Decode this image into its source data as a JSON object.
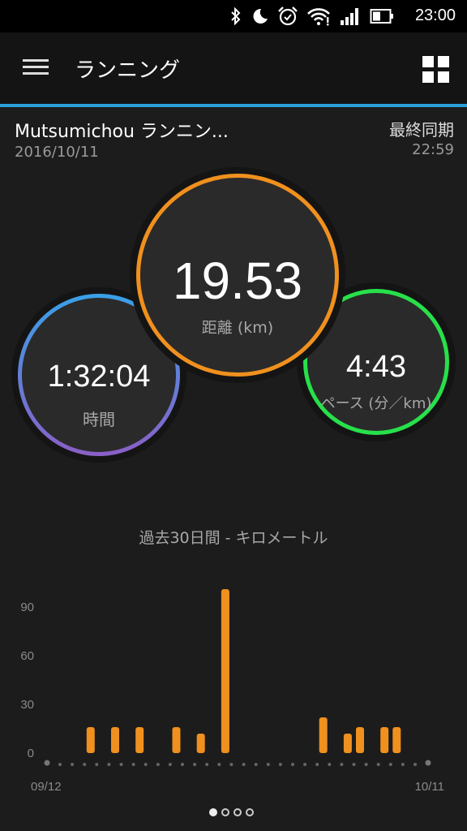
{
  "status_bar": {
    "time": "23:00",
    "icons": [
      "bluetooth-icon",
      "moon-icon",
      "alarm-icon",
      "wifi-icon",
      "signal-icon",
      "battery-icon"
    ]
  },
  "app_bar": {
    "title": "ランニング",
    "icons": [
      "menu-icon",
      "grid-icon"
    ],
    "accent_color": "#2a9fd8"
  },
  "activity": {
    "name": "Mutsumichou ランニン...",
    "date": "2016/10/11",
    "sync_label": "最終同期",
    "sync_time": "22:59"
  },
  "stats": {
    "time": {
      "value": "1:32:04",
      "label": "時間",
      "colors": [
        "#3aa0e8",
        "#8a5fc6"
      ]
    },
    "distance": {
      "value": "19.53",
      "label": "距離 (km)",
      "color": "#f0901e"
    },
    "pace": {
      "value": "4:43",
      "label": "ペース (分／km)",
      "color": "#27e04a"
    }
  },
  "chart_title": "過去30日間 - キロメートル",
  "chart_data": {
    "type": "bar",
    "title": "過去30日間 - キロメートル",
    "x_start_label": "09/12",
    "x_end_label": "10/11",
    "yticks": [
      0,
      30,
      60,
      90
    ],
    "ylim": [
      0,
      105
    ],
    "bar_color": "#f0901e",
    "days": 30,
    "values": [
      0,
      0,
      16,
      0,
      16,
      0,
      16,
      0,
      0,
      16,
      0,
      12,
      0,
      101,
      0,
      0,
      0,
      0,
      0,
      0,
      0,
      22,
      0,
      12,
      16,
      0,
      16,
      16,
      0,
      0
    ],
    "grid": false
  },
  "pager": {
    "count": 4,
    "active": 0
  }
}
